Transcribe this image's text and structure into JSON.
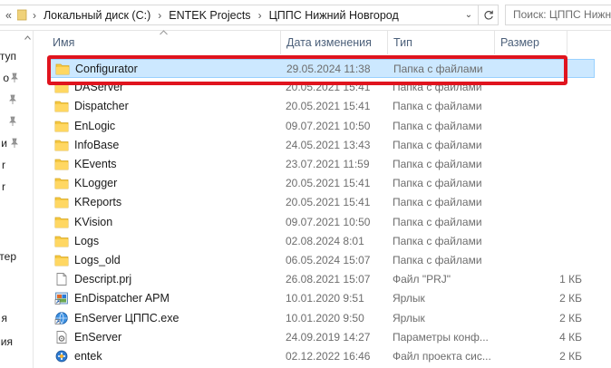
{
  "address_bar": {
    "overflow": "«",
    "crumbs": [
      "Локальный диск (C:)",
      "ENTEK Projects",
      "ЦППС Нижний Новгород"
    ],
    "separator": "›",
    "dropdown": "⌄",
    "search_placeholder": "Поиск: ЦППС Нижни"
  },
  "nav_pane": {
    "items": [
      "туп",
      "о",
      "",
      "",
      "и",
      "r",
      "r",
      "тер",
      "я",
      "ия"
    ]
  },
  "columns": {
    "name": "Имя",
    "date": "Дата изменения",
    "type": "Тип",
    "size": "Размер"
  },
  "rows": [
    {
      "name": "Configurator",
      "date": "29.05.2024 11:38",
      "type": "Папка с файлами",
      "size": "",
      "icon": "folder-icon",
      "selected": true
    },
    {
      "name": "DAServer",
      "date": "20.05.2021 15:41",
      "type": "Папка с файлами",
      "size": "",
      "icon": "folder-icon"
    },
    {
      "name": "Dispatcher",
      "date": "20.05.2021 15:41",
      "type": "Папка с файлами",
      "size": "",
      "icon": "folder-icon"
    },
    {
      "name": "EnLogic",
      "date": "09.07.2021 10:50",
      "type": "Папка с файлами",
      "size": "",
      "icon": "folder-icon"
    },
    {
      "name": "InfoBase",
      "date": "24.05.2021 13:43",
      "type": "Папка с файлами",
      "size": "",
      "icon": "folder-icon"
    },
    {
      "name": "KEvents",
      "date": "23.07.2021 11:59",
      "type": "Папка с файлами",
      "size": "",
      "icon": "folder-icon"
    },
    {
      "name": "KLogger",
      "date": "20.05.2021 15:41",
      "type": "Папка с файлами",
      "size": "",
      "icon": "folder-icon"
    },
    {
      "name": "KReports",
      "date": "20.05.2021 15:41",
      "type": "Папка с файлами",
      "size": "",
      "icon": "folder-icon"
    },
    {
      "name": "KVision",
      "date": "09.07.2021 10:50",
      "type": "Папка с файлами",
      "size": "",
      "icon": "folder-icon"
    },
    {
      "name": "Logs",
      "date": "02.08.2024 8:01",
      "type": "Папка с файлами",
      "size": "",
      "icon": "folder-icon"
    },
    {
      "name": "Logs_old",
      "date": "06.05.2024 15:07",
      "type": "Папка с файлами",
      "size": "",
      "icon": "folder-icon"
    },
    {
      "name": "Descript.prj",
      "date": "26.08.2021 15:07",
      "type": "Файл \"PRJ\"",
      "size": "1 КБ",
      "icon": "file-icon"
    },
    {
      "name": "EnDispatcher APM",
      "date": "10.01.2020 9:51",
      "type": "Ярлык",
      "size": "2 КБ",
      "icon": "shortcut-icon"
    },
    {
      "name": "EnServer ЦППС.exe",
      "date": "10.01.2020 9:50",
      "type": "Ярлык",
      "size": "2 КБ",
      "icon": "globe-shortcut-icon"
    },
    {
      "name": "EnServer",
      "date": "24.09.2019 14:27",
      "type": "Параметры конф...",
      "size": "4 КБ",
      "icon": "config-file-icon"
    },
    {
      "name": "entek",
      "date": "02.12.2022 16:46",
      "type": "Файл проекта сис...",
      "size": "2 КБ",
      "icon": "project-file-icon"
    }
  ],
  "colors": {
    "selection_fill": "#cce8ff",
    "selection_border": "#99d1ff",
    "annotation_red": "#e0141e",
    "folder_yellow": "#f5c842",
    "header_text": "#4c607a"
  }
}
